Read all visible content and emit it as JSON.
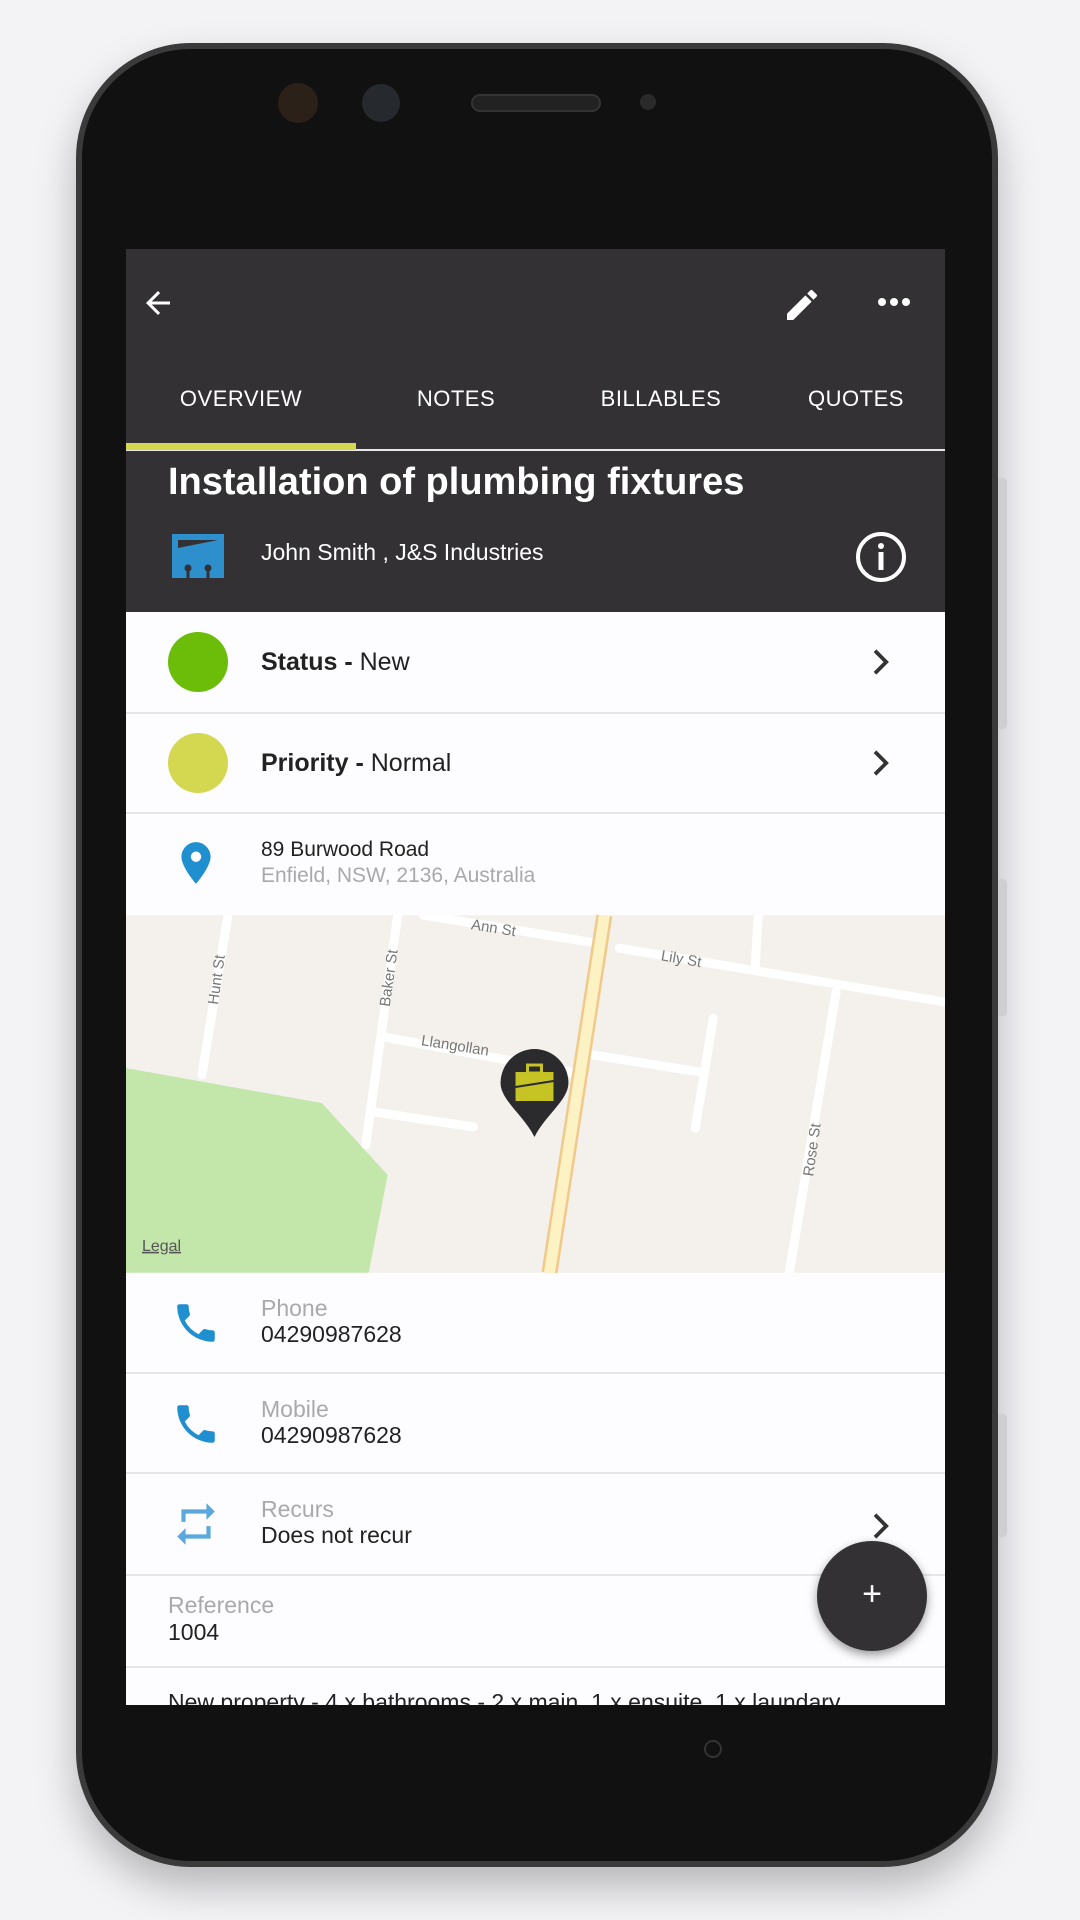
{
  "toolbar": {
    "back_icon": "arrow-left-icon",
    "edit_icon": "pencil-icon",
    "more_icon": "more-horizontal-icon"
  },
  "tabs": [
    {
      "label": "OVERVIEW",
      "active": true
    },
    {
      "label": "NOTES"
    },
    {
      "label": "BILLABLES"
    },
    {
      "label": "QUOTES"
    }
  ],
  "header": {
    "title": "Installation of plumbing fixtures",
    "owner": "John Smith , J&S Industries",
    "info_icon": "info-icon"
  },
  "status": {
    "label": "Status - ",
    "value": "New",
    "color": "#6cbc0a"
  },
  "priority": {
    "label": "Priority - ",
    "value": "Normal",
    "color": "#d4d850"
  },
  "address": {
    "line1": "89 Burwood Road",
    "line2": "Enfield, NSW, 2136, Australia"
  },
  "map": {
    "streets": [
      "Ann St",
      "Lily St",
      "Hunt St",
      "Baker St",
      "Llangollan",
      "Rose St"
    ],
    "legal": "Legal",
    "marker_icon": "briefcase-icon"
  },
  "phone": {
    "label": "Phone",
    "value": "04290987628"
  },
  "mobile": {
    "label": "Mobile",
    "value": "04290987628"
  },
  "recurs": {
    "label": "Recurs",
    "value": "Does not recur"
  },
  "reference": {
    "label": "Reference",
    "value": "1004"
  },
  "description": "New property - 4 x bathrooms - 2 x main, 1 x ensuite, 1 x laundary",
  "fab": {
    "label": "+"
  },
  "colors": {
    "accent": "#d4d850",
    "bar": "#333134",
    "icon_blue": "#1f8fcf"
  }
}
